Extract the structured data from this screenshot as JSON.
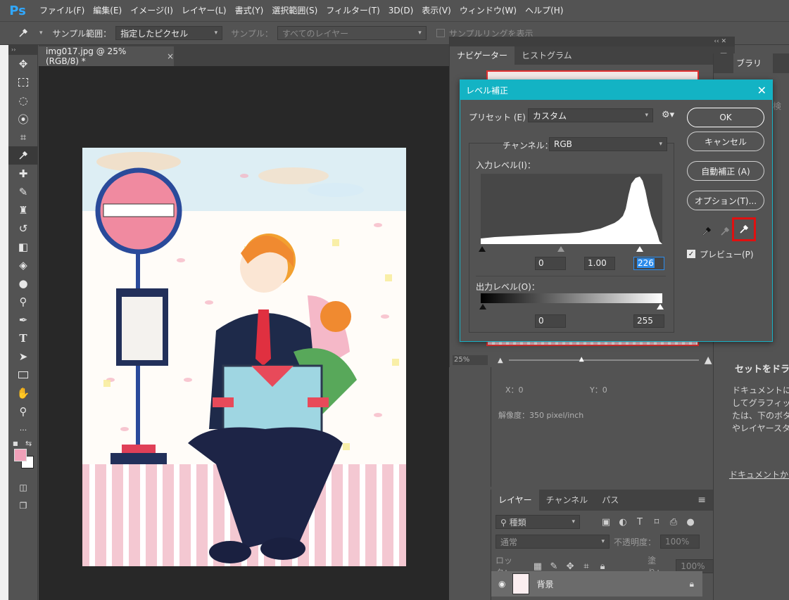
{
  "app": {
    "logo": "Ps"
  },
  "menu": [
    "ファイル(F)",
    "編集(E)",
    "イメージ(I)",
    "レイヤー(L)",
    "書式(Y)",
    "選択範囲(S)",
    "フィルター(T)",
    "3D(D)",
    "表示(V)",
    "ウィンドウ(W)",
    "ヘルプ(H)"
  ],
  "options": {
    "sample_size_label": "サンプル範囲：",
    "sample_size_value": "指定したピクセル",
    "sample_label": "サンプル：",
    "sample_value": "すべてのレイヤー",
    "show_ring_label": "サンプルリングを表示"
  },
  "document": {
    "tab_title": "img017.jpg @ 25% (RGB/8) *",
    "close": "×"
  },
  "navigator": {
    "tabs": [
      "ナビゲーター",
      "ヒストグラム"
    ],
    "zoom": "25%"
  },
  "library": {
    "tab": "ブラリ",
    "search_hint": "を検",
    "drop_title": "セットをドラ",
    "line1": "ドキュメントに",
    "line2": "してグラフィック",
    "line3": "たは、下のボタン",
    "line4": "やレイヤースタ",
    "link": "ドキュメントから"
  },
  "info": {
    "x_label": "X：0",
    "y_label": "Y：0",
    "resolution": "解像度：350 pixel/inch"
  },
  "layers": {
    "tabs": [
      "レイヤー",
      "チャンネル",
      "パス"
    ],
    "filter_label": "種類",
    "blend_mode": "通常",
    "opacity_label": "不透明度：",
    "opacity_value": "100%",
    "lock_label": "ロック：",
    "fill_label": "塗り：",
    "fill_value": "100%",
    "layer_name": "背景"
  },
  "levels": {
    "title": "レベル補正",
    "preset_label": "プリセット (E) :",
    "preset_value": "カスタム",
    "channel_label": "チャンネル：",
    "channel_value": "RGB",
    "input_label": "入力レベル(I)：",
    "input_black": "0",
    "input_gamma": "1.00",
    "input_white": "226",
    "output_label": "出力レベル(O)：",
    "output_black": "0",
    "output_white": "255",
    "buttons": {
      "ok": "OK",
      "cancel": "キャンセル",
      "auto": "自動補正 (A)",
      "options": "オプション(T)..."
    },
    "preview_label": "プレビュー(P)",
    "preview_checked": true
  },
  "colors": {
    "dialog_title_bg": "#13b3c4",
    "highlight_red": "#e01010",
    "foreground_swatch": "#f0a0b8"
  }
}
